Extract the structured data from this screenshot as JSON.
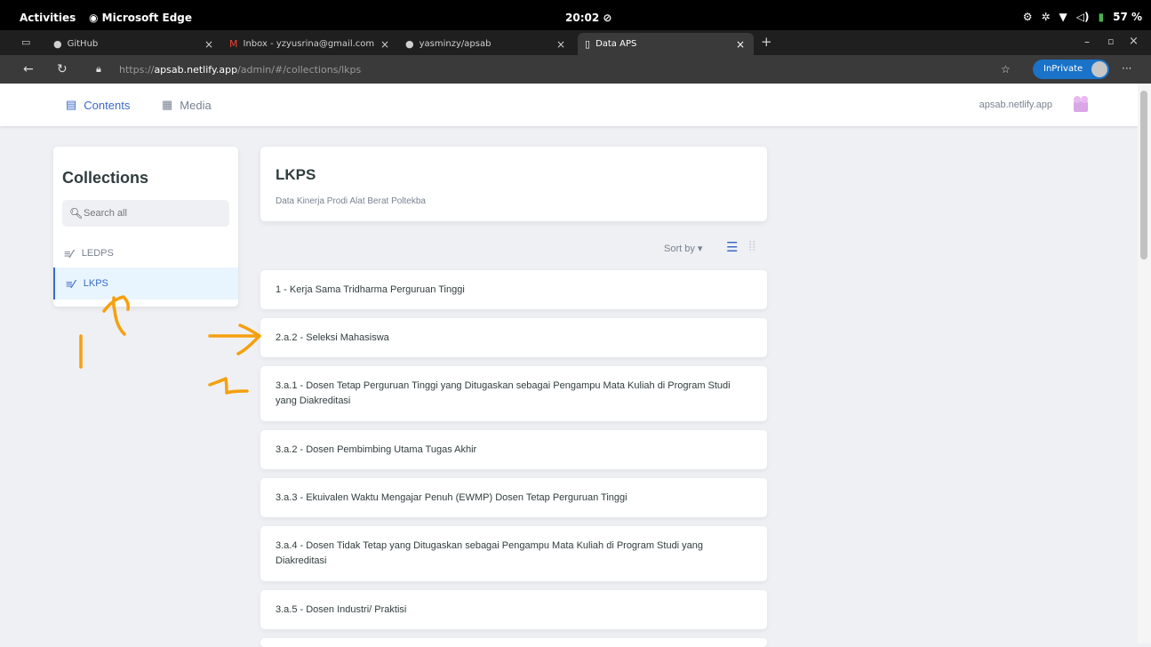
{
  "system": {
    "activities": "Activities",
    "app_name": "Microsoft Edge",
    "clock": "20:02",
    "battery": "57 %"
  },
  "tabs": [
    {
      "title": "GitHub"
    },
    {
      "title": "Inbox - yzyusrina@gmail.com"
    },
    {
      "title": "yasminzy/apsab"
    },
    {
      "title": "Data APS"
    }
  ],
  "address": {
    "prefix": "https://",
    "host": "apsab.netlify.app",
    "path": "/admin/#/collections/lkps",
    "inprivate": "InPrivate"
  },
  "header": {
    "contents": "Contents",
    "media": "Media",
    "site": "apsab.netlify.app"
  },
  "sidebar": {
    "title": "Collections",
    "search_placeholder": "Search all",
    "items": [
      {
        "label": "LEDPS"
      },
      {
        "label": "LKPS"
      }
    ]
  },
  "collection": {
    "title": "LKPS",
    "description": "Data Kinerja Prodi Alat Berat Poltekba",
    "sort_label": "Sort by"
  },
  "entries": [
    "1 - Kerja Sama Tridharma Perguruan Tinggi",
    "2.a.2 - Seleksi Mahasiswa",
    "3.a.1 - Dosen Tetap Perguruan Tinggi yang Ditugaskan sebagai Pengampu Mata Kuliah di Program Studi yang Diakreditasi",
    "3.a.2 - Dosen Pembimbing Utama Tugas Akhir",
    "3.a.3 - Ekuivalen Waktu Mengajar Penuh (EWMP) Dosen Tetap Perguruan Tinggi",
    "3.a.4 - Dosen Tidak Tetap yang Ditugaskan sebagai Pengampu Mata Kuliah di Program Studi yang Diakreditasi",
    "3.a.5 - Dosen Industri/ Praktisi"
  ],
  "colors": {
    "accent": "#3a69c7",
    "annotation": "#f5a00f",
    "inprivate": "#1a73c8"
  }
}
